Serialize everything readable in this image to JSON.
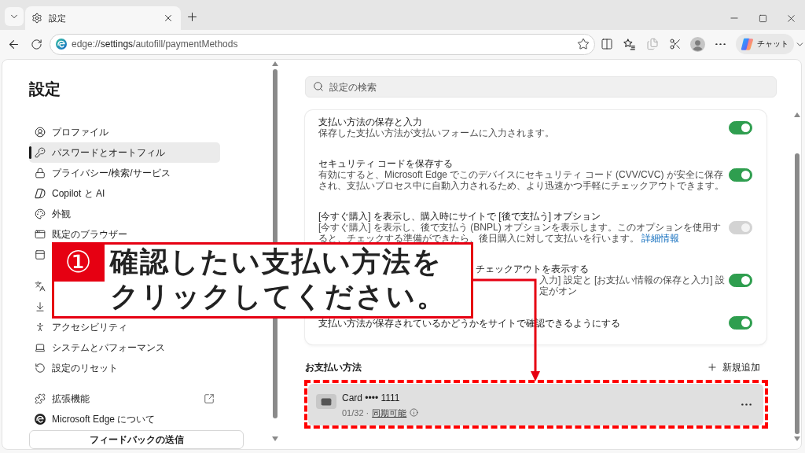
{
  "tabs": [
    {
      "title": "設定",
      "selected": true
    }
  ],
  "address_bar": {
    "url": "edge://**settings**/autofill/paymentMethods"
  },
  "toolbar": {
    "chat_label": "チャット"
  },
  "sidebar": {
    "title": "設定",
    "groups": [
      {
        "items": [
          {
            "label": "プロファイル",
            "selected": false,
            "external": false
          },
          {
            "label": "パスワードとオートフィル",
            "selected": true,
            "external": false
          },
          {
            "label": "プライバシー/検索/サービス",
            "selected": false,
            "external": false
          },
          {
            "label": "Copilot と AI",
            "selected": false,
            "external": false
          },
          {
            "label": "外観",
            "selected": false,
            "external": false
          },
          {
            "label": "既定のブラウザー",
            "selected": false,
            "external": false
          },
          {
            "selected": false,
            "external": false
          }
        ]
      },
      {
        "items": [
          {
            "selected": false,
            "external": false
          },
          {
            "selected": false,
            "external": false
          },
          {
            "label": "アクセシビリティ",
            "selected": false,
            "external": false
          },
          {
            "label": "システムとパフォーマンス",
            "selected": false,
            "external": false
          },
          {
            "label": "設定のリセット",
            "selected": false,
            "external": false
          }
        ]
      },
      {
        "items": [
          {
            "label": "拡張機能",
            "selected": false,
            "external": true
          },
          {
            "label": "Microsoft Edge について",
            "selected": false,
            "external": false
          }
        ]
      }
    ],
    "feedback_button": "フィードバックの送信"
  },
  "search": {
    "placeholder": "設定の検索"
  },
  "settings": [
    {
      "kind": "full",
      "title": "支払い方法の保存と入力",
      "description": "保存した支払い方法が支払いフォームに入力されます。",
      "on": true,
      "disabled": false
    },
    {
      "kind": "full",
      "title": "セキュリティ コードを保存する",
      "description": "有効にすると、Microsoft Edge でこのデバイスにセキュリティ コード (CVV/CVC) が安全に保存され、支払いプロセス中に自動入力されるため、より迅速かつ手軽にチェックアウトできます。",
      "on": true,
      "disabled": false
    },
    {
      "kind": "full",
      "title": "[今すぐ購入] を表示し、購入時にサイトで [後で支払う] オプション",
      "description": "[今すぐ購入] を表示し、後で支払う (BNPL) オプションを表示します。このオプションを使用すると、チェックする準備ができたら、後日購入に対して支払いを行います。",
      "link": "詳細情報",
      "on": true,
      "disabled": true
    },
    {
      "kind": "covered",
      "title": "チェックアウトを表示する",
      "description": "入力] 設定と [お支払い情報の保存と入力] 設定がオン",
      "on": true,
      "disabled": false
    },
    {
      "kind": "full",
      "title": "支払い方法が保存されているかどうかをサイトで確認できるようにする",
      "on": true,
      "disabled": false
    }
  ],
  "payment_methods": {
    "heading": "お支払い方法",
    "add_button": "新規追加",
    "cards": [
      {
        "name": "Card •••• 1111",
        "meta": "01/32 ·",
        "sync_link": "同期可能",
        "highlighted": true
      }
    ]
  },
  "callout": {
    "number": "①",
    "lines": [
      "確認したい支払い方法を",
      "クリックしてください。"
    ]
  }
}
